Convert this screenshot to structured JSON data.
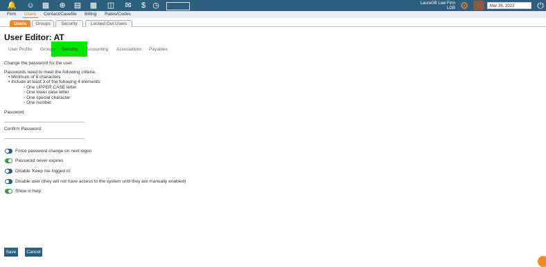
{
  "topbar": {
    "icons": [
      "bell-icon",
      "people-icon",
      "grid-icon",
      "plus-icon",
      "page-icon",
      "calendar-icon",
      "folder-icon",
      "envelope-icon",
      "dollar-icon",
      "lightning-icon",
      "timer-icon"
    ],
    "firm_name": "LauraGB Law Firm",
    "firm_initials": "LGB",
    "date": "Mar 26, 2022"
  },
  "nav": {
    "items": [
      "Firm",
      "Users",
      "Contact/Casefile",
      "Billing",
      "Rates/Codes"
    ],
    "active": "Users"
  },
  "subtabs": [
    "Users",
    "Groups",
    "Security",
    "Locked Out Users"
  ],
  "page": {
    "title": "User Editor: AT",
    "tabs": [
      "User Profile",
      "Groups",
      "Security",
      "Accounting",
      "Associations",
      "Payables"
    ],
    "active_tab": "Security"
  },
  "security": {
    "intro": "Change the password for the user.",
    "criteria_heading": "Passwords need to meet the following criteria:",
    "criteria": [
      "Minimum of 8 characters",
      "Include at least 3 of the following 4 elements:"
    ],
    "elements": [
      "One UPPER CASE letter",
      "One lower case letter",
      "One special character",
      "One number"
    ],
    "password_label": "Password",
    "confirm_label": "Confirm Password",
    "toggles": [
      {
        "label": "Force password change on next logon",
        "on": false
      },
      {
        "label": "Password never expires",
        "on": true
      },
      {
        "label": "Disable 'Keep me logged in'",
        "on": false
      },
      {
        "label": "Disable user (they will not have access to the system until they are manually enabled)",
        "on": false
      },
      {
        "label": "Show in help",
        "on": true
      }
    ]
  },
  "buttons": {
    "save": "Save",
    "cancel": "Cancel"
  },
  "colors": {
    "header": "#2c5f7e",
    "accent": "#f08a24",
    "highlight": "#00e600",
    "toggle_on": "#3a9a4a"
  }
}
